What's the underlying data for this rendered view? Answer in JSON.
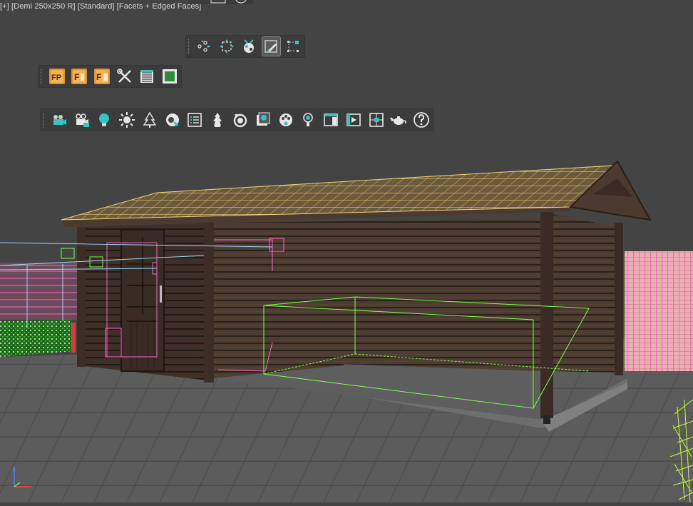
{
  "viewport": {
    "label": {
      "plus": "[+]",
      "camera": "[Demi 250x250 R]",
      "shading": "[Standard]",
      "display": "[Facets + Edged Faces]"
    },
    "background": "#444444"
  },
  "toolbars": {
    "snaps": {
      "buttons": [
        {
          "icon": "scatter-points-icon",
          "active": false
        },
        {
          "icon": "transform-gizmo-icon",
          "active": false
        },
        {
          "icon": "particle-render-icon",
          "active": false
        },
        {
          "icon": "paint-brush-icon",
          "active": true
        },
        {
          "icon": "vertex-grid-icon",
          "active": false
        }
      ]
    },
    "forest": {
      "buttons": [
        {
          "icon": "forest-pack-icon",
          "text": "FP"
        },
        {
          "icon": "forest-pro-icon",
          "text": "F"
        },
        {
          "icon": "forest-set-icon",
          "text": "F"
        },
        {
          "icon": "tools-icon"
        },
        {
          "icon": "list-icon"
        },
        {
          "icon": "green-panel-icon"
        }
      ]
    },
    "render": {
      "buttons": [
        {
          "icon": "vray-camera-icon"
        },
        {
          "icon": "physical-camera-icon"
        },
        {
          "icon": "light-bulb-icon"
        },
        {
          "icon": "sun-icon"
        },
        {
          "icon": "tree-icon"
        },
        {
          "icon": "material-editor-icon"
        },
        {
          "icon": "render-list-icon"
        },
        {
          "icon": "flame-icon"
        },
        {
          "icon": "refresh-icon"
        },
        {
          "icon": "frame-buffer-icon"
        },
        {
          "icon": "palette-icon"
        },
        {
          "icon": "ies-light-icon"
        },
        {
          "icon": "render-window-icon"
        },
        {
          "icon": "render-frame-icon"
        },
        {
          "icon": "target-icon"
        },
        {
          "icon": "teapot-icon"
        },
        {
          "icon": "help-icon"
        }
      ]
    }
  },
  "colors": {
    "wood": "#4a3a30",
    "wood_dark": "#2e241d",
    "roof": "#e8c874",
    "selection_green": "#7cff4a",
    "selection_pink": "#ff66c8",
    "selection_cyan": "#9ad8ff",
    "floor": "#5a5a5a",
    "fence": "#e8b4c0"
  }
}
